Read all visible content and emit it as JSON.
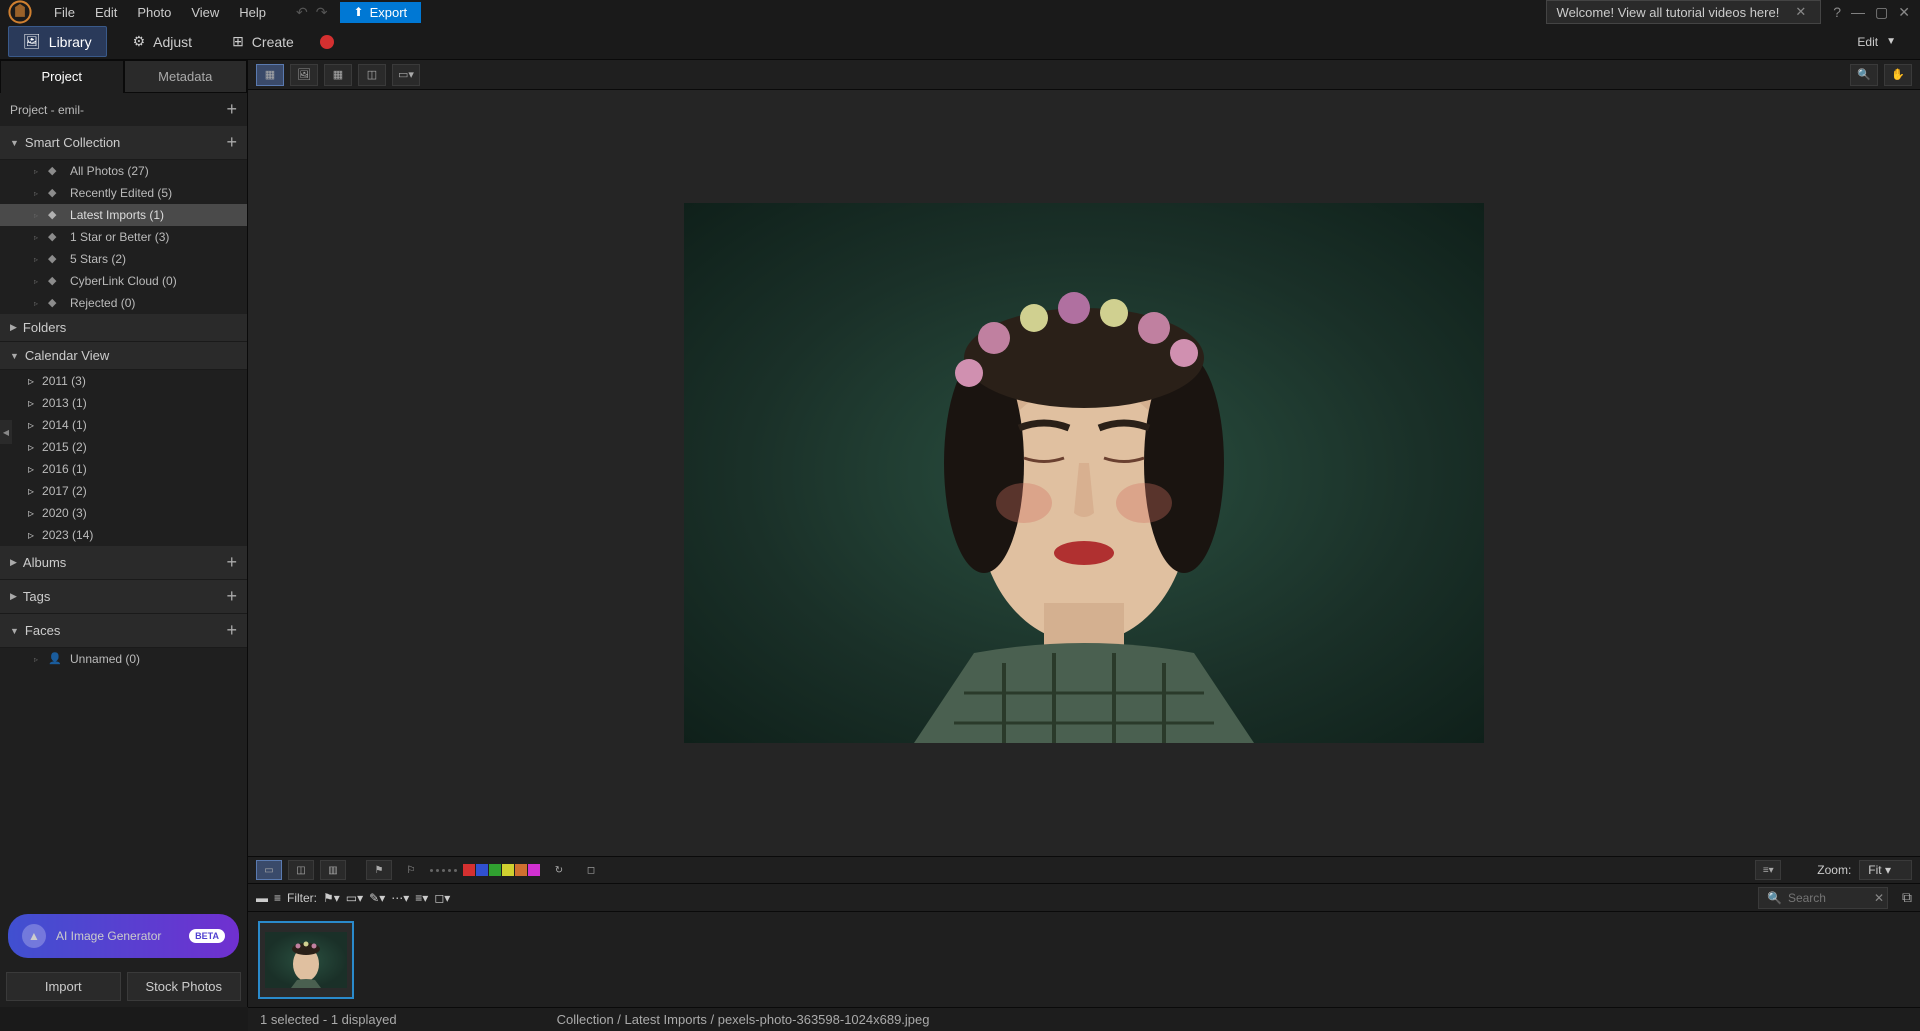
{
  "menubar": {
    "items": [
      "File",
      "Edit",
      "Photo",
      "View",
      "Help"
    ],
    "export": "Export"
  },
  "tutorial_banner": "Welcome! View all tutorial videos here!",
  "modes": {
    "library": "Library",
    "adjust": "Adjust",
    "create": "Create"
  },
  "edit_label": "Edit",
  "sidebar": {
    "tabs": {
      "project": "Project",
      "metadata": "Metadata"
    },
    "project_name": "Project - emil-",
    "smart_collection": {
      "label": "Smart Collection",
      "items": [
        "All Photos (27)",
        "Recently Edited (5)",
        "Latest Imports (1)",
        "1 Star or Better (3)",
        "5 Stars (2)",
        "CyberLink Cloud (0)",
        "Rejected (0)"
      ]
    },
    "folders": "Folders",
    "calendar": {
      "label": "Calendar View",
      "items": [
        "2011 (3)",
        "2013 (1)",
        "2014 (1)",
        "2015 (2)",
        "2016 (1)",
        "2017 (2)",
        "2020 (3)",
        "2023 (14)"
      ]
    },
    "albums": "Albums",
    "tags": "Tags",
    "faces": {
      "label": "Faces",
      "unnamed": "Unnamed (0)"
    },
    "ai_gen": {
      "label": "AI Image Generator",
      "badge": "BETA"
    },
    "import": "Import",
    "stock": "Stock Photos"
  },
  "filter_label": "Filter:",
  "zoom": {
    "label": "Zoom:",
    "value": "Fit"
  },
  "search_placeholder": "Search",
  "status": {
    "selection": "1 selected - 1 displayed",
    "path": "Collection / Latest Imports / pexels-photo-363598-1024x689.jpeg"
  },
  "colors": [
    "#d43030",
    "#3050d0",
    "#30a030",
    "#d0d030",
    "#d07030",
    "#d030d0"
  ]
}
